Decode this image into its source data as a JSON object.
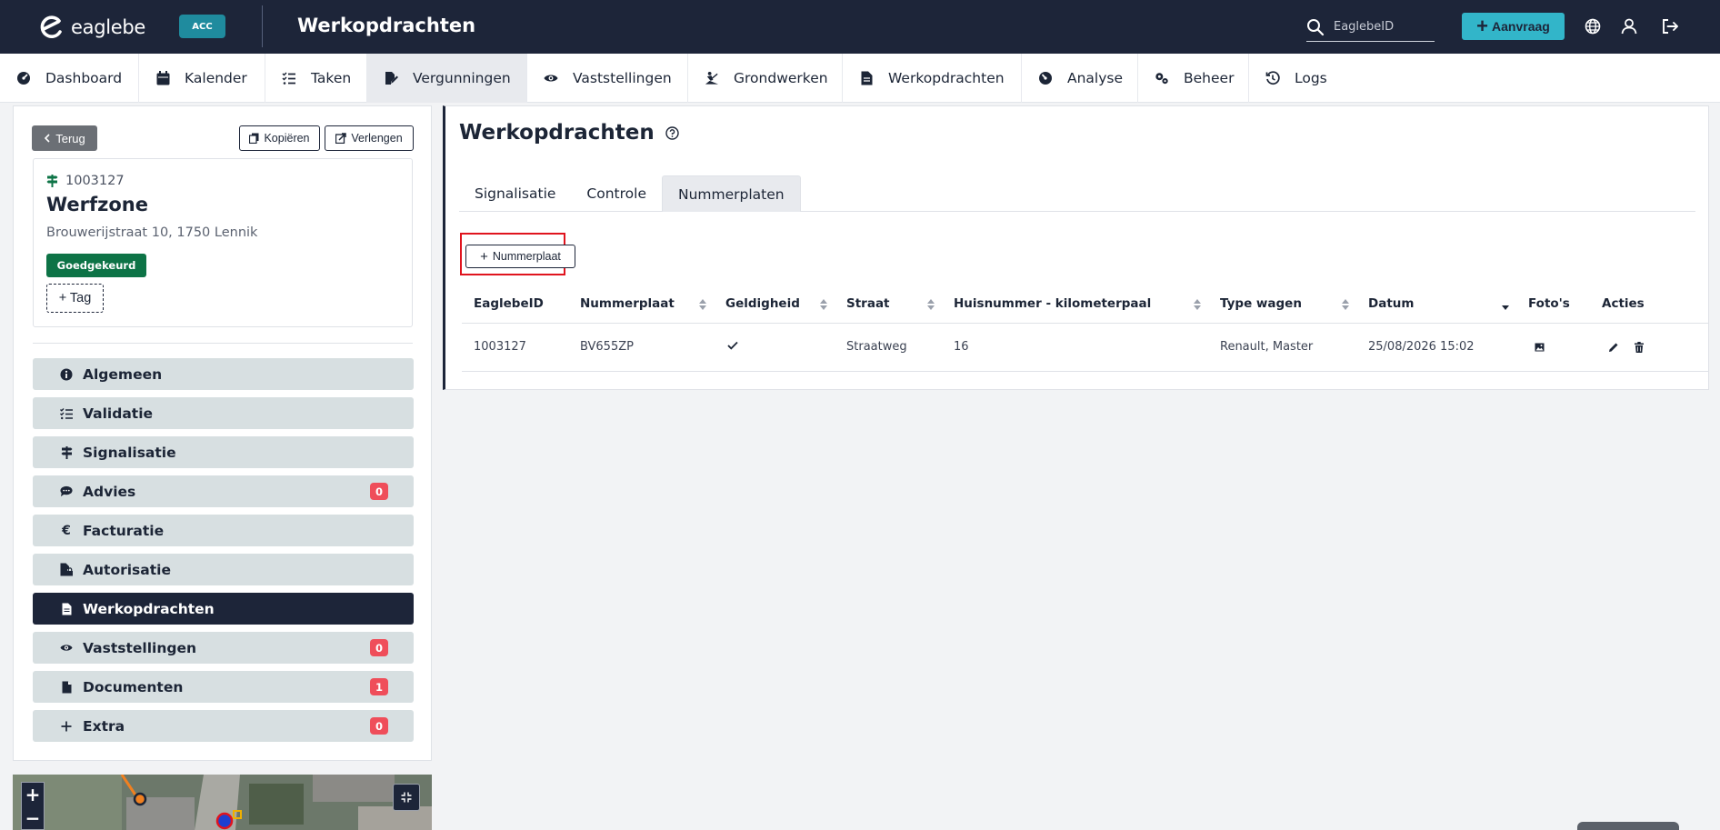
{
  "app": {
    "logo_text": "eaglebe",
    "env_badge": "ACC",
    "page_title": "Werkopdrachten",
    "search_placeholder": "EaglebeID",
    "aanvraag_label": "Aanvraag"
  },
  "nav": [
    {
      "label": "Dashboard",
      "icon": "dashboard-icon"
    },
    {
      "label": "Kalender",
      "icon": "calendar-icon"
    },
    {
      "label": "Taken",
      "icon": "tasks-icon"
    },
    {
      "label": "Vergunningen",
      "icon": "permit-icon"
    },
    {
      "label": "Vaststellingen",
      "icon": "eye-icon"
    },
    {
      "label": "Grondwerken",
      "icon": "digging-icon"
    },
    {
      "label": "Werkopdrachten",
      "icon": "document-icon"
    },
    {
      "label": "Analyse",
      "icon": "gauge-icon"
    },
    {
      "label": "Beheer",
      "icon": "cogs-icon"
    },
    {
      "label": "Logs",
      "icon": "history-icon"
    }
  ],
  "permit": {
    "back_label": "Terug",
    "copy_label": "Kopiëren",
    "extend_label": "Verlengen",
    "id": "1003127",
    "name": "Werfzone",
    "address": "Brouwerijstraat 10, 1750 Lennik",
    "status": "Goedgekeurd",
    "tag_label": "+ Tag"
  },
  "menu": [
    {
      "label": "Algemeen",
      "icon": "info-icon",
      "count": null
    },
    {
      "label": "Validatie",
      "icon": "checklist-icon",
      "count": null
    },
    {
      "label": "Signalisatie",
      "icon": "signpost-icon",
      "count": null
    },
    {
      "label": "Advies",
      "icon": "comments-icon",
      "count": "0"
    },
    {
      "label": "Facturatie",
      "icon": "euro-icon",
      "count": null
    },
    {
      "label": "Autorisatie",
      "icon": "file-lock-icon",
      "count": null
    },
    {
      "label": "Werkopdrachten",
      "icon": "document-icon",
      "count": null
    },
    {
      "label": "Vaststellingen",
      "icon": "eye-icon",
      "count": "0"
    },
    {
      "label": "Documenten",
      "icon": "file-icon",
      "count": "1"
    },
    {
      "label": "Extra",
      "icon": "plus-icon",
      "count": "0"
    }
  ],
  "main": {
    "title": "Werkopdrachten",
    "tabs": [
      "Signalisatie",
      "Controle",
      "Nummerplaten"
    ],
    "add_button": "Nummerplaat",
    "columns": [
      "EaglebeID",
      "Nummerplaat",
      "Geldigheid",
      "Straat",
      "Huisnummer - kilometerpaal",
      "Type wagen",
      "Datum",
      "Foto's",
      "Acties"
    ],
    "rows": [
      {
        "eaglebe_id": "1003127",
        "plate": "BV655ZP",
        "street": "Straatweg",
        "number": "16",
        "vehicle": "Renault, Master",
        "date": "25/08/2026 15:02"
      }
    ]
  },
  "colors": {
    "header_bg": "#1d2539",
    "accent": "#32b5c9",
    "approved": "#0d7346",
    "count_badge": "#ef4e5a",
    "highlight": "#e0141e"
  }
}
